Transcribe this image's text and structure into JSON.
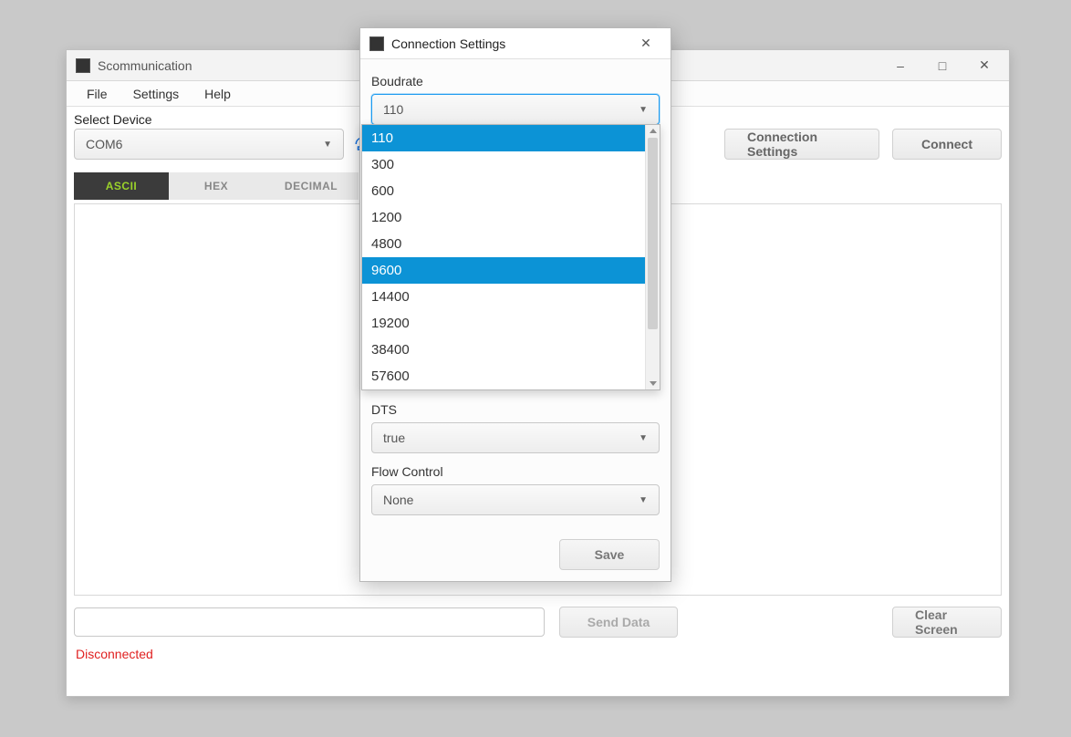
{
  "main": {
    "app_title": "Scommunication",
    "menu": {
      "file": "File",
      "settings": "Settings",
      "help": "Help"
    },
    "select_device_label": "Select Device",
    "device_value": "COM6",
    "buttons": {
      "connection_settings": "Connection Settings",
      "connect": "Connect",
      "send_data": "Send Data",
      "clear_screen": "Clear Screen"
    },
    "tabs": {
      "ascii": "ASCII",
      "hex": "HEX",
      "decimal": "DECIMAL"
    },
    "input_value": "",
    "status": "Disconnected"
  },
  "dialog": {
    "title": "Connection Settings",
    "baud_label": "Boudrate",
    "baud_value": "110",
    "baud_options": [
      "110",
      "300",
      "600",
      "1200",
      "4800",
      "9600",
      "14400",
      "19200",
      "38400",
      "57600"
    ],
    "baud_highlighted": "9600",
    "dts_label": "DTS",
    "dts_value": "true",
    "flow_label": "Flow Control",
    "flow_value": "None",
    "save": "Save"
  }
}
